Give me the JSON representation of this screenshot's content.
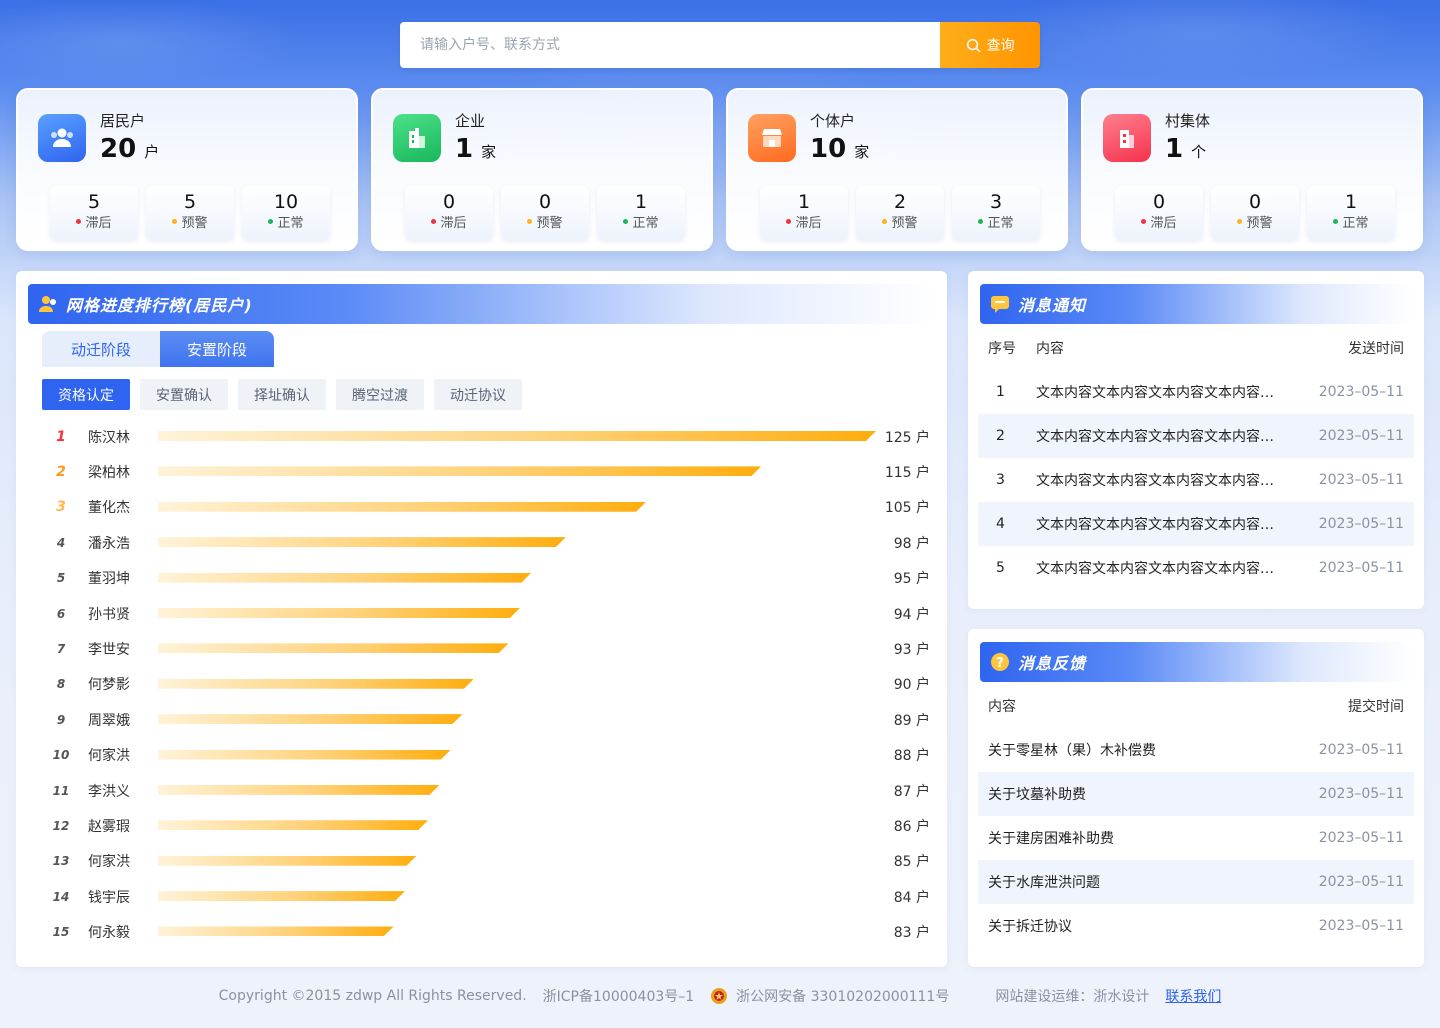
{
  "search": {
    "placeholder": "请输入户号、联系方式",
    "button_label": "查询"
  },
  "colors": {
    "late": "#f5323c",
    "warn": "#ffb21a",
    "normal": "#1eb45a",
    "accent": "#2f64f0"
  },
  "stats": [
    {
      "title": "居民户",
      "count": "20",
      "unit": "户",
      "icon": "residents-icon",
      "items": [
        {
          "value": "5",
          "label": "滞后"
        },
        {
          "value": "5",
          "label": "预警"
        },
        {
          "value": "10",
          "label": "正常"
        }
      ]
    },
    {
      "title": "企业",
      "count": "1",
      "unit": "家",
      "icon": "enterprise-icon",
      "items": [
        {
          "value": "0",
          "label": "滞后"
        },
        {
          "value": "0",
          "label": "预警"
        },
        {
          "value": "1",
          "label": "正常"
        }
      ]
    },
    {
      "title": "个体户",
      "count": "10",
      "unit": "家",
      "icon": "shop-icon",
      "items": [
        {
          "value": "1",
          "label": "滞后"
        },
        {
          "value": "2",
          "label": "预警"
        },
        {
          "value": "3",
          "label": "正常"
        }
      ]
    },
    {
      "title": "村集体",
      "count": "1",
      "unit": "个",
      "icon": "village-icon",
      "items": [
        {
          "value": "0",
          "label": "滞后"
        },
        {
          "value": "0",
          "label": "预警"
        },
        {
          "value": "1",
          "label": "正常"
        }
      ]
    }
  ],
  "ranking": {
    "title": "网格进度排行榜(居民户)",
    "stage_tabs": [
      "动迁阶段",
      "安置阶段"
    ],
    "sub_tabs": [
      "资格认定",
      "安置确认",
      "择址确认",
      "腾空过渡",
      "动迁协议"
    ],
    "unit": "户",
    "rows": [
      {
        "rank": "1",
        "name": "陈汉林",
        "value": 125
      },
      {
        "rank": "2",
        "name": "梁柏林",
        "value": 115
      },
      {
        "rank": "3",
        "name": "董化杰",
        "value": 105
      },
      {
        "rank": "4",
        "name": "潘永浩",
        "value": 98
      },
      {
        "rank": "5",
        "name": "董羽坤",
        "value": 95
      },
      {
        "rank": "6",
        "name": "孙书贤",
        "value": 94
      },
      {
        "rank": "7",
        "name": "李世安",
        "value": 93
      },
      {
        "rank": "8",
        "name": "何梦影",
        "value": 90
      },
      {
        "rank": "9",
        "name": "周翠娥",
        "value": 89
      },
      {
        "rank": "10",
        "name": "何家洪",
        "value": 88
      },
      {
        "rank": "11",
        "name": "李洪义",
        "value": 87
      },
      {
        "rank": "12",
        "name": "赵雾瑕",
        "value": 86
      },
      {
        "rank": "13",
        "name": "何家洪",
        "value": 85
      },
      {
        "rank": "14",
        "name": "钱宇辰",
        "value": 84
      },
      {
        "rank": "15",
        "name": "何永毅",
        "value": 83
      }
    ]
  },
  "notices": {
    "title": "消息通知",
    "headers": {
      "idx": "序号",
      "content": "内容",
      "time": "发送时间"
    },
    "rows": [
      {
        "idx": "1",
        "content": "文本内容文本内容文本内容文本内容文本内容文本内容",
        "time": "2023–05–11"
      },
      {
        "idx": "2",
        "content": "文本内容文本内容文本内容文本内容文本内容文本内容",
        "time": "2023–05–11"
      },
      {
        "idx": "3",
        "content": "文本内容文本内容文本内容文本内容文本内容文本内容",
        "time": "2023–05–11"
      },
      {
        "idx": "4",
        "content": "文本内容文本内容文本内容文本内容文本内容文本内容",
        "time": "2023–05–11"
      },
      {
        "idx": "5",
        "content": "文本内容文本内容文本内容文本内容文本内容文本内容",
        "time": "2023–05–11"
      }
    ]
  },
  "feedback": {
    "title": "消息反馈",
    "headers": {
      "content": "内容",
      "time": "提交时间"
    },
    "rows": [
      {
        "content": "关于零星林（果）木补偿费",
        "time": "2023–05–11"
      },
      {
        "content": "关于坟墓补助费",
        "time": "2023–05–11"
      },
      {
        "content": "关于建房困难补助费",
        "time": "2023–05–11"
      },
      {
        "content": "关于水库泄洪问题",
        "time": "2023–05–11"
      },
      {
        "content": "关于拆迁协议",
        "time": "2023–05–11"
      }
    ]
  },
  "footer": {
    "copyright": "Copyright ©2015 zdwp All Rights Reserved.",
    "icp": "浙ICP备10000403号–1",
    "police": "浙公网安备 33010202000111号",
    "maintainer": "网站建设运维：浙水设计",
    "contact": "联系我们"
  }
}
